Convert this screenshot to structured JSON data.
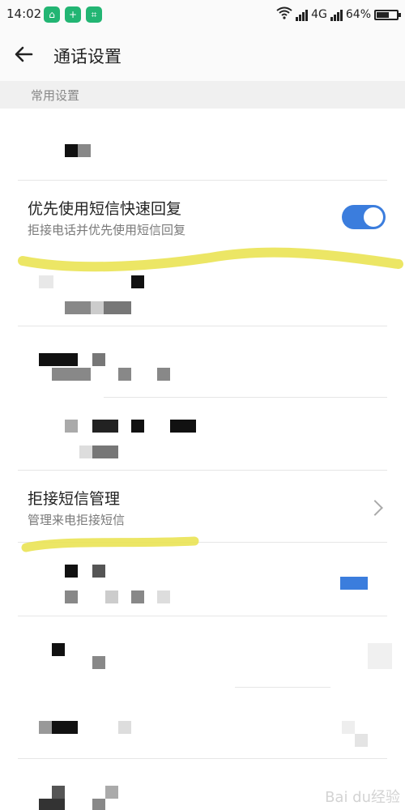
{
  "status_bar": {
    "time": "14:02",
    "network": "4G",
    "battery": "64%",
    "battery_level": 0.64,
    "apps": [
      "app-a-icon",
      "app-b-icon",
      "scan-icon"
    ]
  },
  "header": {
    "title": "通话设置",
    "back_icon": "arrow-left-icon"
  },
  "section": {
    "label": "常用设置"
  },
  "settings": [
    {
      "title": "优先使用短信快速回复",
      "subtitle": "拒接电话并优先使用短信回复",
      "control": "toggle",
      "enabled": true
    },
    {
      "title": "拒接短信管理",
      "subtitle": "管理来电拒接短信",
      "control": "chevron"
    }
  ],
  "colors": {
    "accent": "#3b7ddd",
    "highlight": "#e9e24a",
    "divider": "#e6e6e6",
    "section_bg": "#f0f0f0"
  },
  "watermark": "Bai du经验"
}
